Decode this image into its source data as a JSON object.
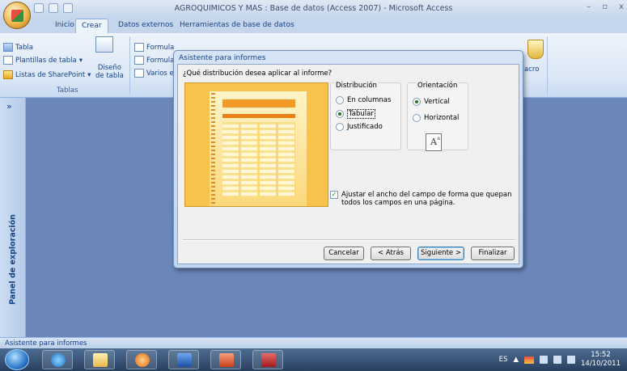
{
  "window": {
    "title": "AGROQUIMICOS Y MAS : Base de datos (Access 2007) - Microsoft Access",
    "controls": {
      "minimize": "–",
      "restore": "▫",
      "close": "x"
    }
  },
  "ribbon": {
    "tabs": [
      "Inicio",
      "Crear",
      "Datos externos",
      "Herramientas de base de datos"
    ],
    "active_tab": "Crear",
    "tablas_group": {
      "items": [
        "Tabla",
        "Plantillas de tabla",
        "Listas de SharePoint"
      ],
      "design_label_line1": "Diseño",
      "design_label_line2": "de tabla",
      "group_label": "Tablas"
    },
    "forms_group": {
      "items": [
        "Formula",
        "Formula",
        "Varios el"
      ]
    },
    "macro_label": "acro"
  },
  "nav": {
    "toggle": "»",
    "label": "Panel de exploración"
  },
  "statusbar": {
    "text": "Asistente para informes"
  },
  "taskbar": {
    "buttons": [
      "ie-icon",
      "explorer-icon",
      "media-player-icon",
      "word-icon",
      "powerpoint-icon",
      "access-icon"
    ],
    "tray": {
      "lang": "ES",
      "time": "15:52",
      "date": "14/10/2011"
    }
  },
  "dialog": {
    "title": "Asistente para informes",
    "question": "¿Qué distribución desea aplicar al informe?",
    "distribution": {
      "legend": "Distribución",
      "options": [
        "En columnas",
        "Tabular",
        "Justificado"
      ],
      "selected": "Tabular"
    },
    "orientation": {
      "legend": "Orientación",
      "options": [
        "Vertical",
        "Horizontal"
      ],
      "selected": "Vertical",
      "icon_letter": "A"
    },
    "fit_checkbox": {
      "checked": true,
      "label": "Ajustar el ancho del campo de forma que quepan todos los campos en una página."
    },
    "buttons": {
      "cancel": "Cancelar",
      "back": "< Atrás",
      "next": "Siguiente >",
      "finish": "Finalizar"
    }
  }
}
